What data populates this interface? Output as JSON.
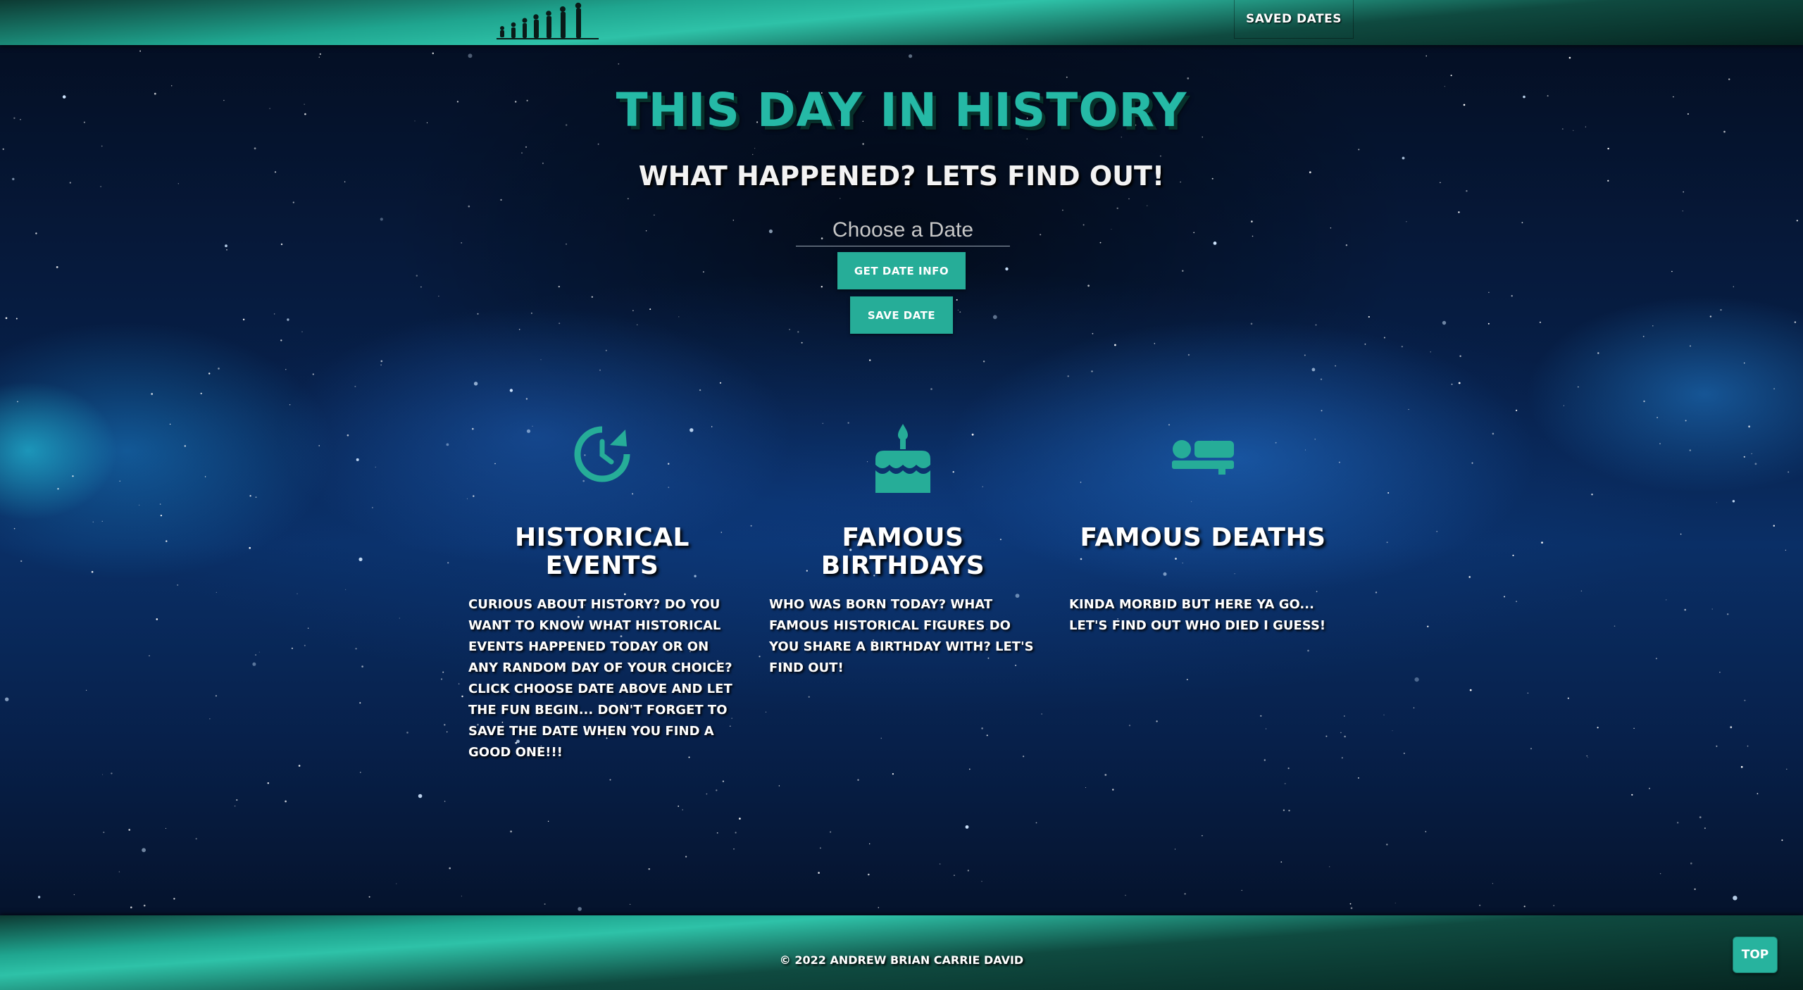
{
  "header": {
    "saved_dates_label": "SAVED DATES"
  },
  "hero": {
    "title": "THIS DAY IN HISTORY",
    "subtitle": "WHAT HAPPENED? LETS FIND OUT!",
    "date_input": {
      "placeholder": "Choose a Date",
      "value": ""
    },
    "get_info_label": "GET DATE INFO",
    "save_label": "SAVE DATE"
  },
  "features": [
    {
      "icon": "clock-history-icon",
      "title": "HISTORICAL EVENTS",
      "text": "CURIOUS ABOUT HISTORY? DO YOU WANT TO KNOW WHAT HISTORICAL EVENTS HAPPENED TODAY OR ON ANY RANDOM DAY OF YOUR CHOICE? CLICK CHOOSE DATE ABOVE AND LET THE FUN BEGIN... DON'T FORGET TO SAVE THE DATE WHEN YOU FIND A GOOD ONE!!!"
    },
    {
      "icon": "birthday-cake-icon",
      "title": "FAMOUS BIRTHDAYS",
      "text": "WHO WAS BORN TODAY? WHAT FAMOUS HISTORICAL FIGURES DO YOU SHARE A BIRTHDAY WITH? LET'S FIND OUT!"
    },
    {
      "icon": "bed-icon",
      "title": "FAMOUS DEATHS",
      "text": "KINDA MORBID BUT HERE YA GO... LET'S FIND OUT WHO DIED I GUESS!"
    }
  ],
  "footer": {
    "copyright": "© 2022 ANDREW BRIAN CARRIE DAVID",
    "top_label": "TOP"
  },
  "colors": {
    "accent": "#26ad98",
    "title": "#25b9a6",
    "background": "#06142b"
  }
}
